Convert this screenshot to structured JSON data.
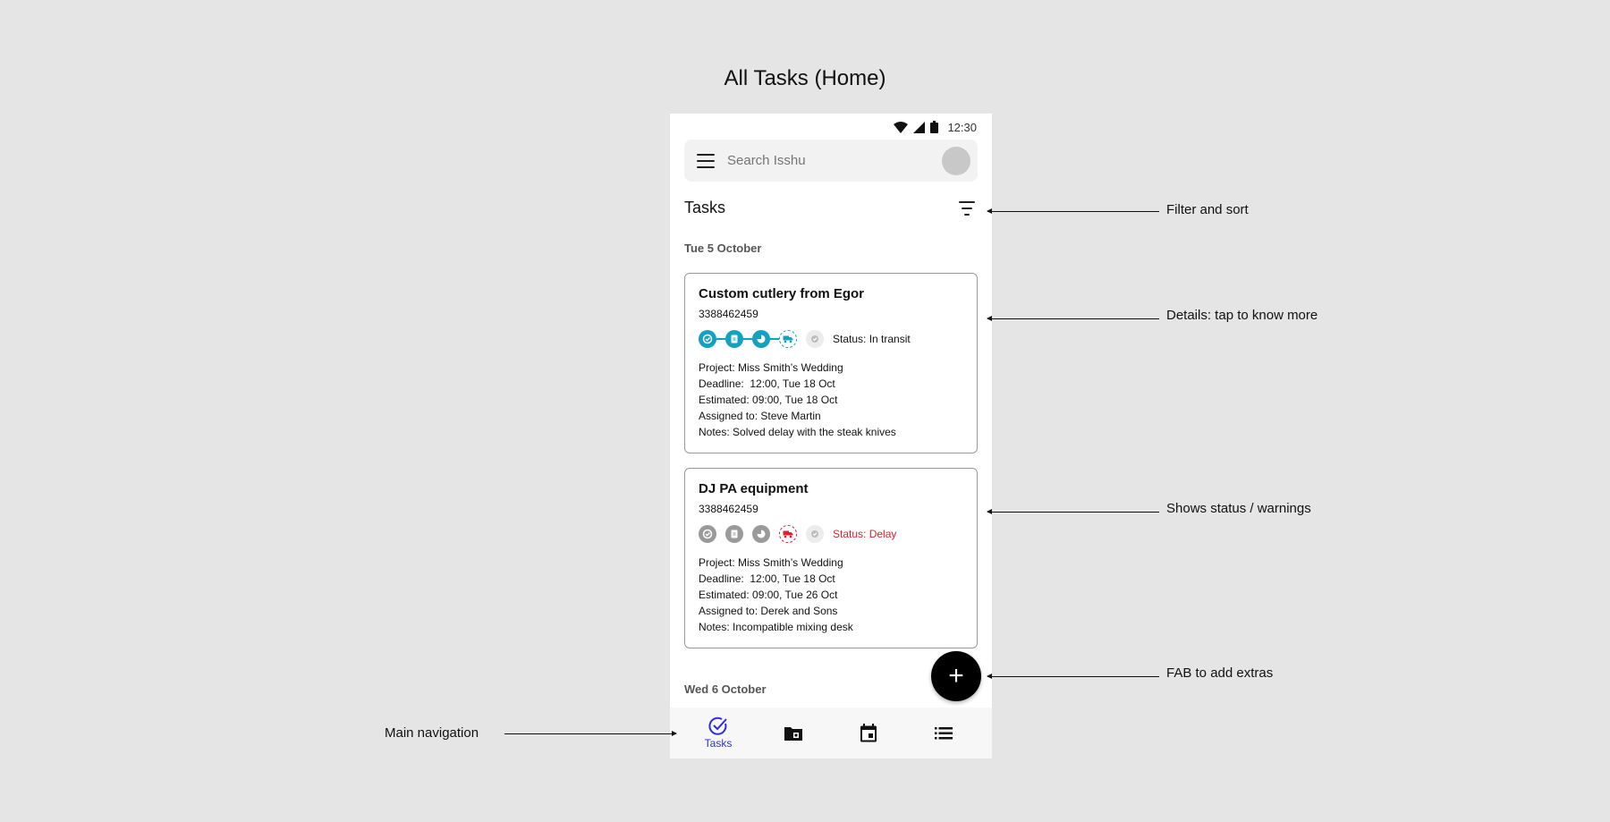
{
  "page_title": "All Tasks (Home)",
  "statusbar": {
    "time": "12:30"
  },
  "search": {
    "placeholder": "Search Isshu"
  },
  "tasks_header": {
    "title": "Tasks"
  },
  "dates": [
    "Tue 5 October",
    "Wed 6 October"
  ],
  "cards": [
    {
      "title": "Custom cutlery from Egor",
      "id": "3388462459",
      "status": "Status: In transit",
      "status_color": "#111111",
      "project": "Project: Miss Smith’s Wedding",
      "deadline": "Deadline:  12:00, Tue 18 Oct",
      "estimated": "Estimated: 09:00, Tue 18 Oct",
      "assigned": "Assigned to: Steve Martin",
      "notes": "Notes: Solved delay with the steak knives"
    },
    {
      "title": "DJ PA equipment",
      "id": "3388462459",
      "status": "Status: Delay",
      "status_color": "#e0202e",
      "project": "Project: Miss Smith’s Wedding",
      "deadline": "Deadline:  12:00, Tue 18 Oct",
      "estimated": "Estimated: 09:00, Tue 26 Oct",
      "assigned": "Assigned to: Derek and Sons",
      "notes": "Notes: Incompatible mixing desk"
    }
  ],
  "fab": {
    "icon": "plus-icon",
    "label": "+"
  },
  "bottom_nav": [
    {
      "label": "Tasks",
      "icon": "check-circle-icon",
      "active": true
    },
    {
      "label": "",
      "icon": "folder-icon",
      "active": false
    },
    {
      "label": "",
      "icon": "calendar-icon",
      "active": false
    },
    {
      "label": "",
      "icon": "list-icon",
      "active": false
    }
  ],
  "annotations": {
    "filter": "Filter and sort",
    "details": "Details: tap to know more",
    "status": "Shows status / warnings",
    "fab": "FAB to add extras",
    "nav": "Main navigation"
  },
  "colors": {
    "accent_teal": "#14a0c0",
    "warning_red": "#e0202e",
    "nav_active": "#2d2de0",
    "inactive_grey": "#9a9a9a"
  }
}
